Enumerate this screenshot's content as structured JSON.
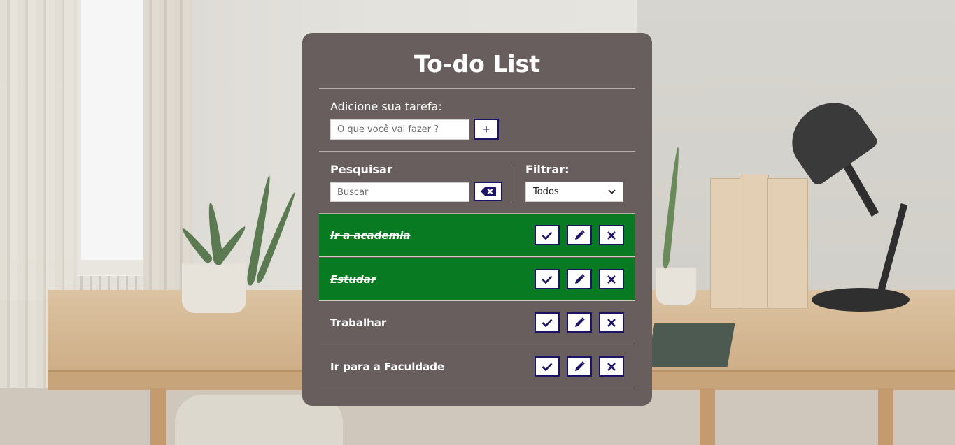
{
  "app": {
    "title": "To-do List"
  },
  "add_form": {
    "label": "Adicione sua tarefa:",
    "placeholder": "O que você vai fazer ?",
    "value": "",
    "submit_label": "+"
  },
  "search": {
    "label": "Pesquisar",
    "placeholder": "Buscar",
    "value": "",
    "clear_icon": "backspace-icon"
  },
  "filter": {
    "label": "Filtrar:",
    "selected": "Todos"
  },
  "todos": [
    {
      "text": "Ir a academia",
      "done": true
    },
    {
      "text": "Estudar",
      "done": true
    },
    {
      "text": "Trabalhar",
      "done": false
    },
    {
      "text": "Ir para a Faculdade",
      "done": false
    }
  ],
  "colors": {
    "card": "#675e5d",
    "done": "#077a22",
    "button_border": "#1b1466",
    "text": "#ffffff"
  }
}
